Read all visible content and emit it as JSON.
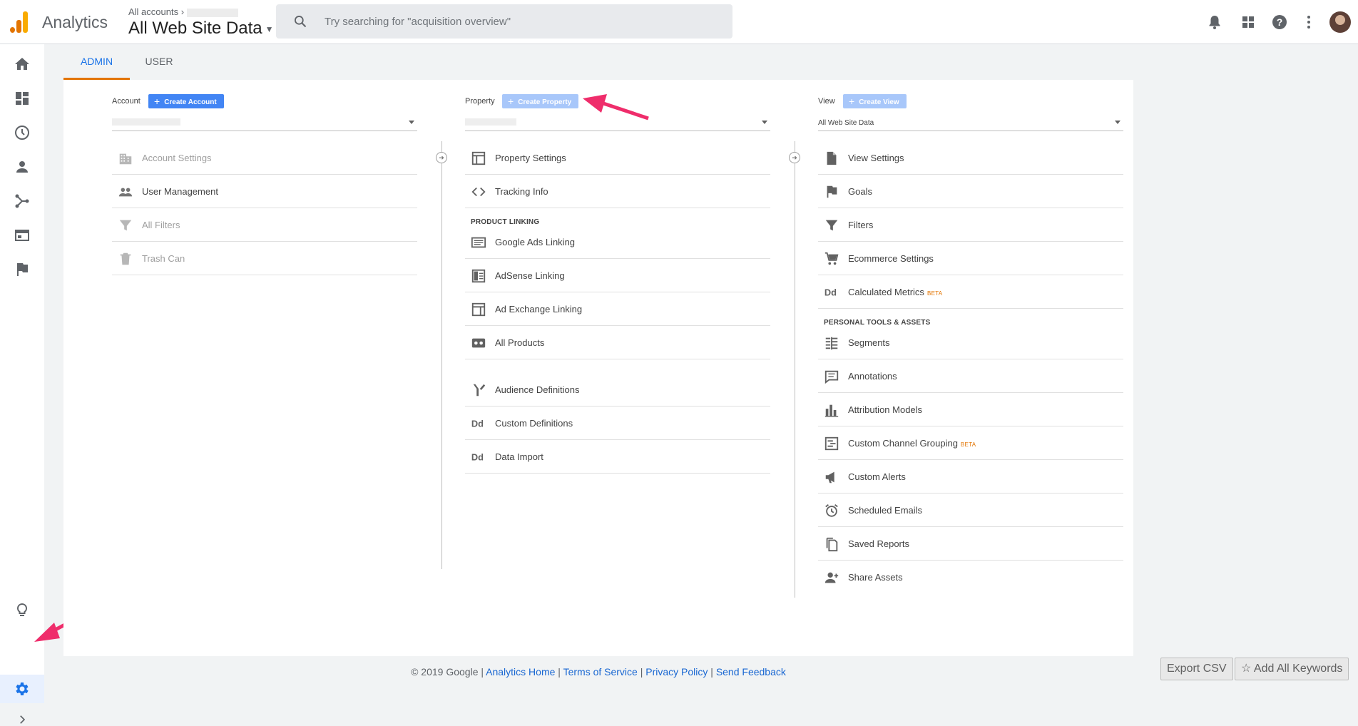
{
  "header": {
    "app_name": "Analytics",
    "breadcrumb": "All accounts",
    "view_name": "All Web Site Data",
    "search_placeholder": "Try searching for \"acquisition overview\""
  },
  "tabs": {
    "admin": "ADMIN",
    "user": "USER"
  },
  "account": {
    "label": "Account",
    "create_button": "Create Account",
    "items": [
      {
        "label": "Account Settings",
        "icon": "building-icon"
      },
      {
        "label": "User Management",
        "icon": "people-icon"
      },
      {
        "label": "All Filters",
        "icon": "filter-icon"
      },
      {
        "label": "Trash Can",
        "icon": "trash-icon"
      }
    ]
  },
  "property": {
    "label": "Property",
    "create_button": "Create Property",
    "items": [
      {
        "label": "Property Settings",
        "icon": "layout-icon"
      },
      {
        "label": "Tracking Info",
        "icon": "code-icon"
      }
    ],
    "section_product_linking": "PRODUCT LINKING",
    "linking_items": [
      {
        "label": "Google Ads Linking",
        "icon": "ads-icon"
      },
      {
        "label": "AdSense Linking",
        "icon": "adsense-icon"
      },
      {
        "label": "Ad Exchange Linking",
        "icon": "adexchange-icon"
      },
      {
        "label": "All Products",
        "icon": "products-icon"
      }
    ],
    "other_items": [
      {
        "label": "Audience Definitions",
        "icon": "fork-icon"
      },
      {
        "label": "Custom Definitions",
        "icon": "dd-icon"
      },
      {
        "label": "Data Import",
        "icon": "dd-icon"
      }
    ]
  },
  "view": {
    "label": "View",
    "create_button": "Create View",
    "selected": "All Web Site Data",
    "items": [
      {
        "label": "View Settings",
        "icon": "document-icon"
      },
      {
        "label": "Goals",
        "icon": "flag-icon"
      },
      {
        "label": "Filters",
        "icon": "filter-icon"
      },
      {
        "label": "Ecommerce Settings",
        "icon": "cart-icon"
      },
      {
        "label": "Calculated Metrics",
        "icon": "dd-icon",
        "badge": "BETA"
      }
    ],
    "section_personal_tools": "PERSONAL TOOLS & ASSETS",
    "tool_items": [
      {
        "label": "Segments",
        "icon": "segments-icon"
      },
      {
        "label": "Annotations",
        "icon": "comment-icon"
      },
      {
        "label": "Attribution Models",
        "icon": "bar-chart-icon"
      },
      {
        "label": "Custom Channel Grouping",
        "icon": "channel-icon",
        "badge": "BETA"
      },
      {
        "label": "Custom Alerts",
        "icon": "megaphone-icon"
      },
      {
        "label": "Scheduled Emails",
        "icon": "alarm-icon"
      },
      {
        "label": "Saved Reports",
        "icon": "copy-icon"
      },
      {
        "label": "Share Assets",
        "icon": "person-add-icon"
      }
    ]
  },
  "footer": {
    "copyright": "© 2019 Google |",
    "links": [
      "Analytics Home",
      "Terms of Service",
      "Privacy Policy",
      "Send Feedback"
    ]
  },
  "buttons": {
    "export_csv": "Export CSV",
    "add_all_keywords": "Add All Keywords"
  },
  "colors": {
    "accent": "#1a73e8",
    "tab_underline": "#e37400",
    "create_button": "#4285f4",
    "annotation_arrow": "#ef2d6b"
  }
}
